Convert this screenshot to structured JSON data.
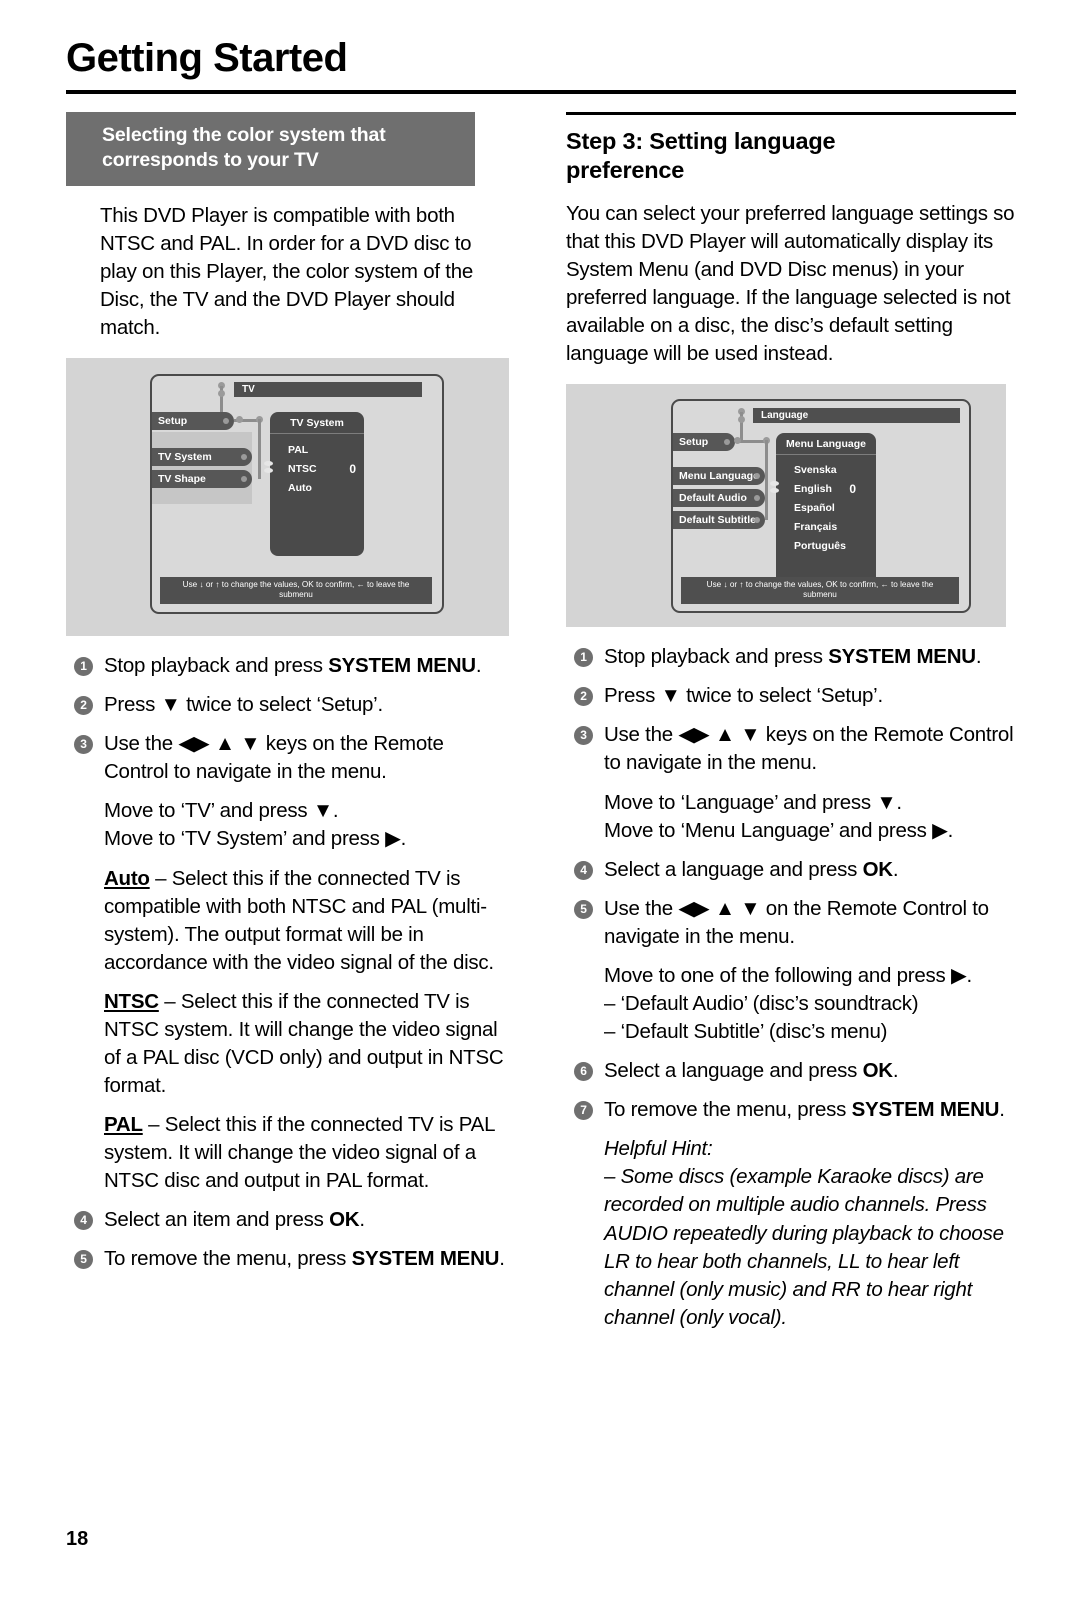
{
  "page": {
    "title": "Getting Started",
    "number": "18"
  },
  "left": {
    "band_line1": "Selecting the color system that",
    "band_line2": "corresponds to your TV",
    "intro": "This DVD Player is compatible with both NTSC and PAL. In order for a DVD disc to play on this Player, the color system of the Disc, the TV and the DVD Player should match.",
    "screenshot": {
      "title_bar": "TV",
      "menu_items": [
        "Setup",
        "TV System",
        "TV Shape"
      ],
      "submenu_title": "TV System",
      "submenu_items": [
        "PAL",
        "NTSC",
        "Auto"
      ],
      "selected_item": "NTSC",
      "value_glyph": "0",
      "hint_line1": "Use ↓ or ↑ to change the values, OK to confirm, ← to leave the",
      "hint_line2": "submenu"
    },
    "steps": [
      {
        "num": "1",
        "text_pre": "Stop playback and press ",
        "bold": "SYSTEM MENU",
        "text_post": "."
      },
      {
        "num": "2",
        "text_pre": "Press ▼ twice to select ‘Setup’.",
        "bold": "",
        "text_post": ""
      },
      {
        "num": "3",
        "text_pre": "Use the ◀▶ ▲ ▼ keys on the Remote Control to navigate in the menu.",
        "bold": "",
        "text_post": ""
      }
    ],
    "move_line1": "Move to ‘TV’ and press ▼.",
    "move_line2": "Move to ‘TV System’ and press ▶.",
    "defs": [
      {
        "term": "Auto",
        "body": " – Select this if the connected TV is compatible with both NTSC and PAL (multi-system). The output format will be in accordance with the video signal of the disc."
      },
      {
        "term": "NTSC",
        "body": " – Select this if the connected TV is NTSC system. It will change the video signal of a PAL disc (VCD only) and output in NTSC format."
      },
      {
        "term": "PAL",
        "body": " – Select this if the connected TV is PAL system. It will change the video signal of a NTSC disc and output in PAL format."
      }
    ],
    "steps_tail": [
      {
        "num": "4",
        "text_pre": "Select an item and press ",
        "bold": "OK",
        "text_post": "."
      },
      {
        "num": "5",
        "text_pre": "To remove the menu, press ",
        "bold": "SYSTEM MENU",
        "text_post": "."
      }
    ]
  },
  "right": {
    "heading_line1": "Step 3:  Setting language",
    "heading_line2": "preference",
    "intro": "You can select your preferred language settings so that this DVD Player will automatically display its System Menu (and DVD Disc menus) in your preferred language. If the language selected is not available on a disc, the disc’s default setting language will be used instead.",
    "screenshot": {
      "title_bar": "Language",
      "menu_items": [
        "Setup",
        "Menu Language",
        "Default Audio",
        "Default Subtitle"
      ],
      "submenu_title": "Menu Language",
      "submenu_items": [
        "Svenska",
        "English",
        "Español",
        "Français",
        "Português"
      ],
      "selected_item": "English",
      "value_glyph": "0",
      "hint_line1": "Use ↓ or ↑ to change the values, OK to confirm, ← to leave the",
      "hint_line2": "submenu"
    },
    "steps": [
      {
        "num": "1",
        "text_pre": "Stop playback and press ",
        "bold": "SYSTEM MENU",
        "text_post": "."
      },
      {
        "num": "2",
        "text_pre": "Press ▼ twice to select ‘Setup’.",
        "bold": "",
        "text_post": ""
      },
      {
        "num": "3",
        "text_pre": "Use the ◀▶ ▲ ▼ keys on the Remote Control to navigate in the menu.",
        "bold": "",
        "text_post": ""
      }
    ],
    "move_line1": "Move to ‘Language’ and press ▼.",
    "move_line2": "Move to ‘Menu Language’ and press ▶.",
    "step4": {
      "num": "4",
      "text_pre": "Select a language and press ",
      "bold": "OK",
      "text_post": "."
    },
    "step5": {
      "num": "5",
      "text_pre": "Use the ◀▶ ▲ ▼ on the Remote Control to navigate in the menu.",
      "bold": "",
      "text_post": ""
    },
    "move2_line1": "Move to one of the following and press ▶.",
    "move2_line2": "– ‘Default Audio’ (disc’s soundtrack)",
    "move2_line3": "– ‘Default Subtitle’ (disc’s menu)",
    "step6": {
      "num": "6",
      "text_pre": "Select a language and press ",
      "bold": "OK",
      "text_post": "."
    },
    "step7": {
      "num": "7",
      "text_pre": "To remove the menu, press ",
      "bold": "SYSTEM MENU",
      "text_post": "."
    },
    "hint_title": "Helpful Hint:",
    "hint_body": "–     Some discs (example Karaoke discs) are recorded on multiple audio channels. Press AUDIO repeatedly during playback to choose LR to hear both channels, LL to hear left channel (only music) and RR to hear right channel (only vocal)."
  }
}
